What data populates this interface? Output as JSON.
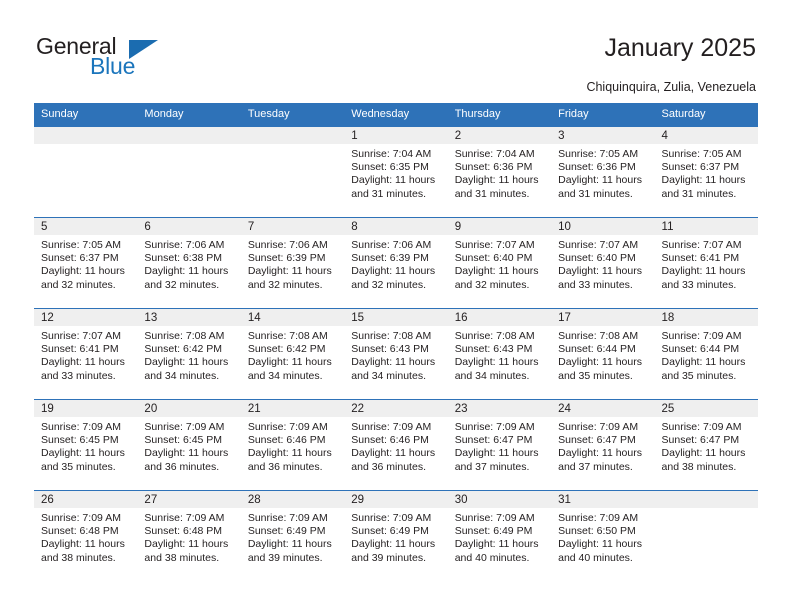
{
  "brand": {
    "word_one": "General",
    "word_two": "Blue",
    "triangle_icon": "triangle-up-right-icon",
    "accent_color": "#1b75bc"
  },
  "header": {
    "title": "January 2025",
    "subtitle": "Chiquinquira, Zulia, Venezuela",
    "header_bg_color": "#2e72b8",
    "daynum_band_color": "#efefef"
  },
  "calendar": {
    "columns": [
      "Sunday",
      "Monday",
      "Tuesday",
      "Wednesday",
      "Thursday",
      "Friday",
      "Saturday"
    ],
    "labels": {
      "sunrise": "Sunrise:",
      "sunset": "Sunset:",
      "daylight": "Daylight:"
    },
    "weeks": [
      [
        {
          "day": "",
          "empty": true
        },
        {
          "day": "",
          "empty": true
        },
        {
          "day": "",
          "empty": true
        },
        {
          "day": "1",
          "sunrise": "Sunrise: 7:04 AM",
          "sunset": "Sunset: 6:35 PM",
          "daylight_line1": "Daylight: 11 hours",
          "daylight_line2": "and 31 minutes."
        },
        {
          "day": "2",
          "sunrise": "Sunrise: 7:04 AM",
          "sunset": "Sunset: 6:36 PM",
          "daylight_line1": "Daylight: 11 hours",
          "daylight_line2": "and 31 minutes."
        },
        {
          "day": "3",
          "sunrise": "Sunrise: 7:05 AM",
          "sunset": "Sunset: 6:36 PM",
          "daylight_line1": "Daylight: 11 hours",
          "daylight_line2": "and 31 minutes."
        },
        {
          "day": "4",
          "sunrise": "Sunrise: 7:05 AM",
          "sunset": "Sunset: 6:37 PM",
          "daylight_line1": "Daylight: 11 hours",
          "daylight_line2": "and 31 minutes."
        }
      ],
      [
        {
          "day": "5",
          "sunrise": "Sunrise: 7:05 AM",
          "sunset": "Sunset: 6:37 PM",
          "daylight_line1": "Daylight: 11 hours",
          "daylight_line2": "and 32 minutes."
        },
        {
          "day": "6",
          "sunrise": "Sunrise: 7:06 AM",
          "sunset": "Sunset: 6:38 PM",
          "daylight_line1": "Daylight: 11 hours",
          "daylight_line2": "and 32 minutes."
        },
        {
          "day": "7",
          "sunrise": "Sunrise: 7:06 AM",
          "sunset": "Sunset: 6:39 PM",
          "daylight_line1": "Daylight: 11 hours",
          "daylight_line2": "and 32 minutes."
        },
        {
          "day": "8",
          "sunrise": "Sunrise: 7:06 AM",
          "sunset": "Sunset: 6:39 PM",
          "daylight_line1": "Daylight: 11 hours",
          "daylight_line2": "and 32 minutes."
        },
        {
          "day": "9",
          "sunrise": "Sunrise: 7:07 AM",
          "sunset": "Sunset: 6:40 PM",
          "daylight_line1": "Daylight: 11 hours",
          "daylight_line2": "and 32 minutes."
        },
        {
          "day": "10",
          "sunrise": "Sunrise: 7:07 AM",
          "sunset": "Sunset: 6:40 PM",
          "daylight_line1": "Daylight: 11 hours",
          "daylight_line2": "and 33 minutes."
        },
        {
          "day": "11",
          "sunrise": "Sunrise: 7:07 AM",
          "sunset": "Sunset: 6:41 PM",
          "daylight_line1": "Daylight: 11 hours",
          "daylight_line2": "and 33 minutes."
        }
      ],
      [
        {
          "day": "12",
          "sunrise": "Sunrise: 7:07 AM",
          "sunset": "Sunset: 6:41 PM",
          "daylight_line1": "Daylight: 11 hours",
          "daylight_line2": "and 33 minutes."
        },
        {
          "day": "13",
          "sunrise": "Sunrise: 7:08 AM",
          "sunset": "Sunset: 6:42 PM",
          "daylight_line1": "Daylight: 11 hours",
          "daylight_line2": "and 34 minutes."
        },
        {
          "day": "14",
          "sunrise": "Sunrise: 7:08 AM",
          "sunset": "Sunset: 6:42 PM",
          "daylight_line1": "Daylight: 11 hours",
          "daylight_line2": "and 34 minutes."
        },
        {
          "day": "15",
          "sunrise": "Sunrise: 7:08 AM",
          "sunset": "Sunset: 6:43 PM",
          "daylight_line1": "Daylight: 11 hours",
          "daylight_line2": "and 34 minutes."
        },
        {
          "day": "16",
          "sunrise": "Sunrise: 7:08 AM",
          "sunset": "Sunset: 6:43 PM",
          "daylight_line1": "Daylight: 11 hours",
          "daylight_line2": "and 34 minutes."
        },
        {
          "day": "17",
          "sunrise": "Sunrise: 7:08 AM",
          "sunset": "Sunset: 6:44 PM",
          "daylight_line1": "Daylight: 11 hours",
          "daylight_line2": "and 35 minutes."
        },
        {
          "day": "18",
          "sunrise": "Sunrise: 7:09 AM",
          "sunset": "Sunset: 6:44 PM",
          "daylight_line1": "Daylight: 11 hours",
          "daylight_line2": "and 35 minutes."
        }
      ],
      [
        {
          "day": "19",
          "sunrise": "Sunrise: 7:09 AM",
          "sunset": "Sunset: 6:45 PM",
          "daylight_line1": "Daylight: 11 hours",
          "daylight_line2": "and 35 minutes."
        },
        {
          "day": "20",
          "sunrise": "Sunrise: 7:09 AM",
          "sunset": "Sunset: 6:45 PM",
          "daylight_line1": "Daylight: 11 hours",
          "daylight_line2": "and 36 minutes."
        },
        {
          "day": "21",
          "sunrise": "Sunrise: 7:09 AM",
          "sunset": "Sunset: 6:46 PM",
          "daylight_line1": "Daylight: 11 hours",
          "daylight_line2": "and 36 minutes."
        },
        {
          "day": "22",
          "sunrise": "Sunrise: 7:09 AM",
          "sunset": "Sunset: 6:46 PM",
          "daylight_line1": "Daylight: 11 hours",
          "daylight_line2": "and 36 minutes."
        },
        {
          "day": "23",
          "sunrise": "Sunrise: 7:09 AM",
          "sunset": "Sunset: 6:47 PM",
          "daylight_line1": "Daylight: 11 hours",
          "daylight_line2": "and 37 minutes."
        },
        {
          "day": "24",
          "sunrise": "Sunrise: 7:09 AM",
          "sunset": "Sunset: 6:47 PM",
          "daylight_line1": "Daylight: 11 hours",
          "daylight_line2": "and 37 minutes."
        },
        {
          "day": "25",
          "sunrise": "Sunrise: 7:09 AM",
          "sunset": "Sunset: 6:47 PM",
          "daylight_line1": "Daylight: 11 hours",
          "daylight_line2": "and 38 minutes."
        }
      ],
      [
        {
          "day": "26",
          "sunrise": "Sunrise: 7:09 AM",
          "sunset": "Sunset: 6:48 PM",
          "daylight_line1": "Daylight: 11 hours",
          "daylight_line2": "and 38 minutes."
        },
        {
          "day": "27",
          "sunrise": "Sunrise: 7:09 AM",
          "sunset": "Sunset: 6:48 PM",
          "daylight_line1": "Daylight: 11 hours",
          "daylight_line2": "and 38 minutes."
        },
        {
          "day": "28",
          "sunrise": "Sunrise: 7:09 AM",
          "sunset": "Sunset: 6:49 PM",
          "daylight_line1": "Daylight: 11 hours",
          "daylight_line2": "and 39 minutes."
        },
        {
          "day": "29",
          "sunrise": "Sunrise: 7:09 AM",
          "sunset": "Sunset: 6:49 PM",
          "daylight_line1": "Daylight: 11 hours",
          "daylight_line2": "and 39 minutes."
        },
        {
          "day": "30",
          "sunrise": "Sunrise: 7:09 AM",
          "sunset": "Sunset: 6:49 PM",
          "daylight_line1": "Daylight: 11 hours",
          "daylight_line2": "and 40 minutes."
        },
        {
          "day": "31",
          "sunrise": "Sunrise: 7:09 AM",
          "sunset": "Sunset: 6:50 PM",
          "daylight_line1": "Daylight: 11 hours",
          "daylight_line2": "and 40 minutes."
        },
        {
          "day": "",
          "empty": true
        }
      ]
    ]
  }
}
